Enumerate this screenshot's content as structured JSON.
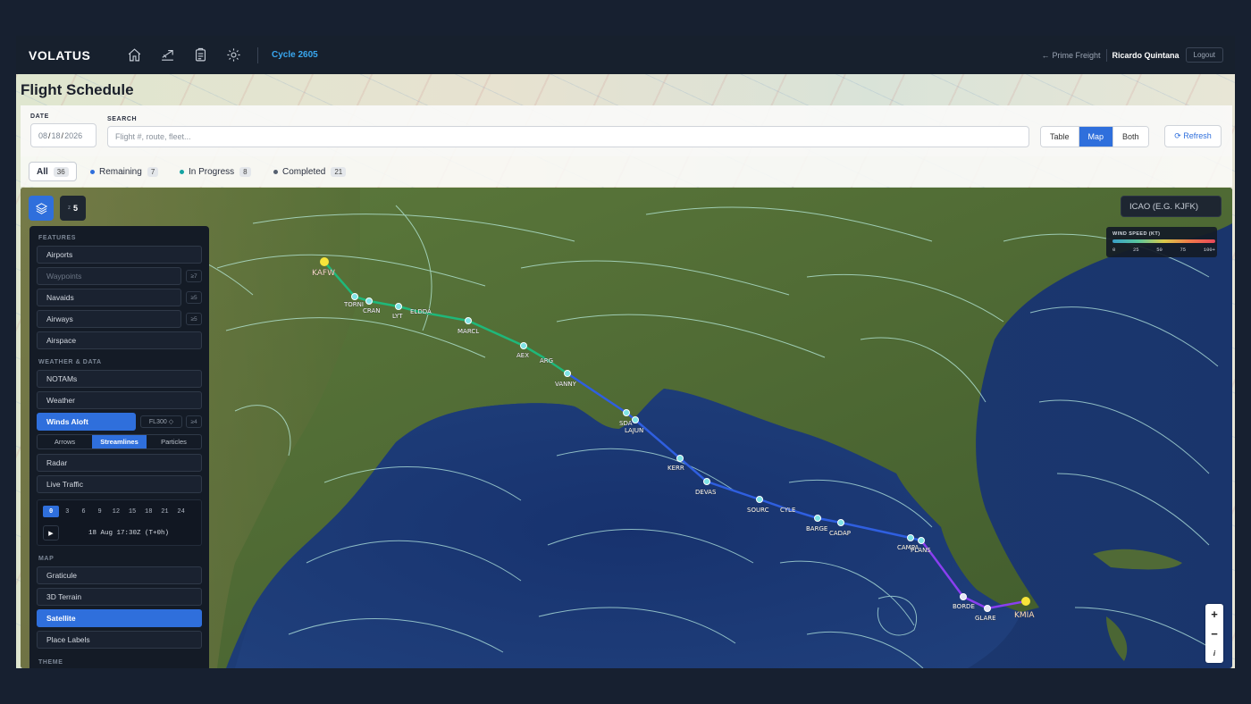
{
  "app": {
    "brand": "VOLATUS",
    "cycle": "Cycle 2605",
    "back_link": "Prime Freight",
    "user": "Ricardo Quintana",
    "logout": "Logout"
  },
  "page": {
    "title": "Flight Schedule"
  },
  "filters": {
    "date_label": "DATE",
    "date_month": "08",
    "date_day": "18",
    "date_year": "2026",
    "search_label": "SEARCH",
    "search_placeholder": "Flight #, route, fleet...",
    "views": [
      "Table",
      "Map",
      "Both"
    ],
    "active_view": "Map",
    "refresh": "⟳ Refresh"
  },
  "tabs": [
    {
      "label": "All",
      "count": "36",
      "color": ""
    },
    {
      "label": "Remaining",
      "count": "7",
      "color": "#2f6fdc"
    },
    {
      "label": "In Progress",
      "count": "8",
      "color": "#13a3a3"
    },
    {
      "label": "Completed",
      "count": "21",
      "color": "#556070"
    }
  ],
  "map": {
    "zoom_prefix": "z",
    "zoom": "5",
    "icao_placeholder": "ICAO (E.G. KJFK)",
    "legend_title": "WIND SPEED (KT)",
    "legend_ticks": [
      "0",
      "25",
      "50",
      "75",
      "100+"
    ],
    "route_labels": [
      "KAFW",
      "TORNI",
      "CRAN",
      "LYT",
      "ELDDA",
      "MARCL",
      "AEX",
      "ARG",
      "VANNY",
      "SDA",
      "LAJUN",
      "KERR",
      "DEVAS",
      "SOURC",
      "CYLE",
      "BARGE",
      "CADAP",
      "CAMPA",
      "PLANS",
      "BORDE",
      "GLARE",
      "KMIA"
    ]
  },
  "panel": {
    "features_title": "FEATURES",
    "features": [
      "Airports",
      "Waypoints",
      "Navaids",
      "Airways",
      "Airspace"
    ],
    "feature_badges": {
      "waypoints": "≥7",
      "navaids": "≥5",
      "airways": "≥5"
    },
    "weather_title": "WEATHER & DATA",
    "weather": [
      "NOTAMs",
      "Weather",
      "Winds Aloft"
    ],
    "winds_level": "FL300 ◇",
    "winds_badge": "≥4",
    "winds_modes": [
      "Arrows",
      "Streamlines",
      "Particles"
    ],
    "active_wind_mode": "Streamlines",
    "extra": [
      "Radar",
      "Live Traffic"
    ],
    "hours": [
      "0",
      "3",
      "6",
      "9",
      "12",
      "15",
      "18",
      "21",
      "24"
    ],
    "active_hour": "0",
    "play": "▶",
    "valid_time": "18 Aug 17:30Z (T+0h)",
    "map_title": "MAP",
    "map_layers": [
      "Graticule",
      "3D Terrain",
      "Satellite",
      "Place Labels"
    ],
    "active_map_layer": "Satellite",
    "theme_title": "THEME"
  },
  "colors": {
    "accent": "#2f6fdc",
    "cycle": "#39a7f0",
    "route_green": "#1fb87a",
    "route_blue": "#2f5fe0",
    "route_purple": "#8a3ff0"
  }
}
